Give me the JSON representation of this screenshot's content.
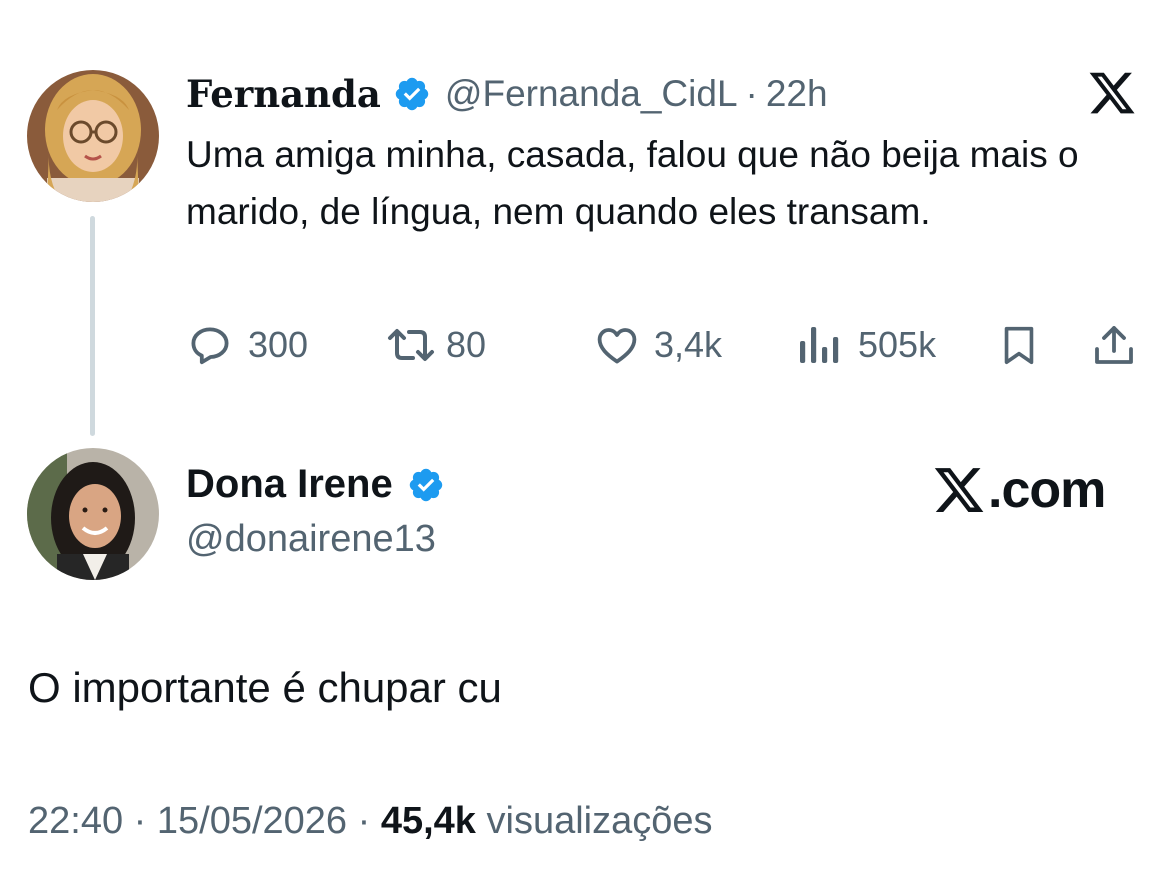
{
  "quoted_tweet": {
    "author_name": "Fernanda",
    "handle": "@Fernanda_CidL",
    "separator": "·",
    "time": "22h",
    "text": "Uma amiga minha, casada, falou que não beija mais o marido, de língua, nem quando eles transam.",
    "actions": {
      "replies": "300",
      "reposts": "80",
      "likes": "3,4k",
      "views": "505k"
    }
  },
  "reply_tweet": {
    "author_name": "Dona Irene",
    "handle": "@donairene13",
    "text": "O importante é chupar cu",
    "time": "22:40",
    "date": "15/05/2026",
    "views_count": "45,4k",
    "views_label": "visualizações",
    "separator": "·"
  },
  "watermark": {
    "text": ".com"
  },
  "colors": {
    "verified_blue": "#1d9bf0",
    "text_primary": "#0f1419",
    "text_secondary": "#536471",
    "thread_line": "#cfd9de"
  },
  "icons": {
    "top_right": "x-logo-icon",
    "reply": "speech-bubble-icon",
    "repost": "repost-arrows-icon",
    "like": "heart-icon",
    "views": "bar-chart-icon",
    "bookmark": "bookmark-icon",
    "share": "share-upload-icon"
  }
}
